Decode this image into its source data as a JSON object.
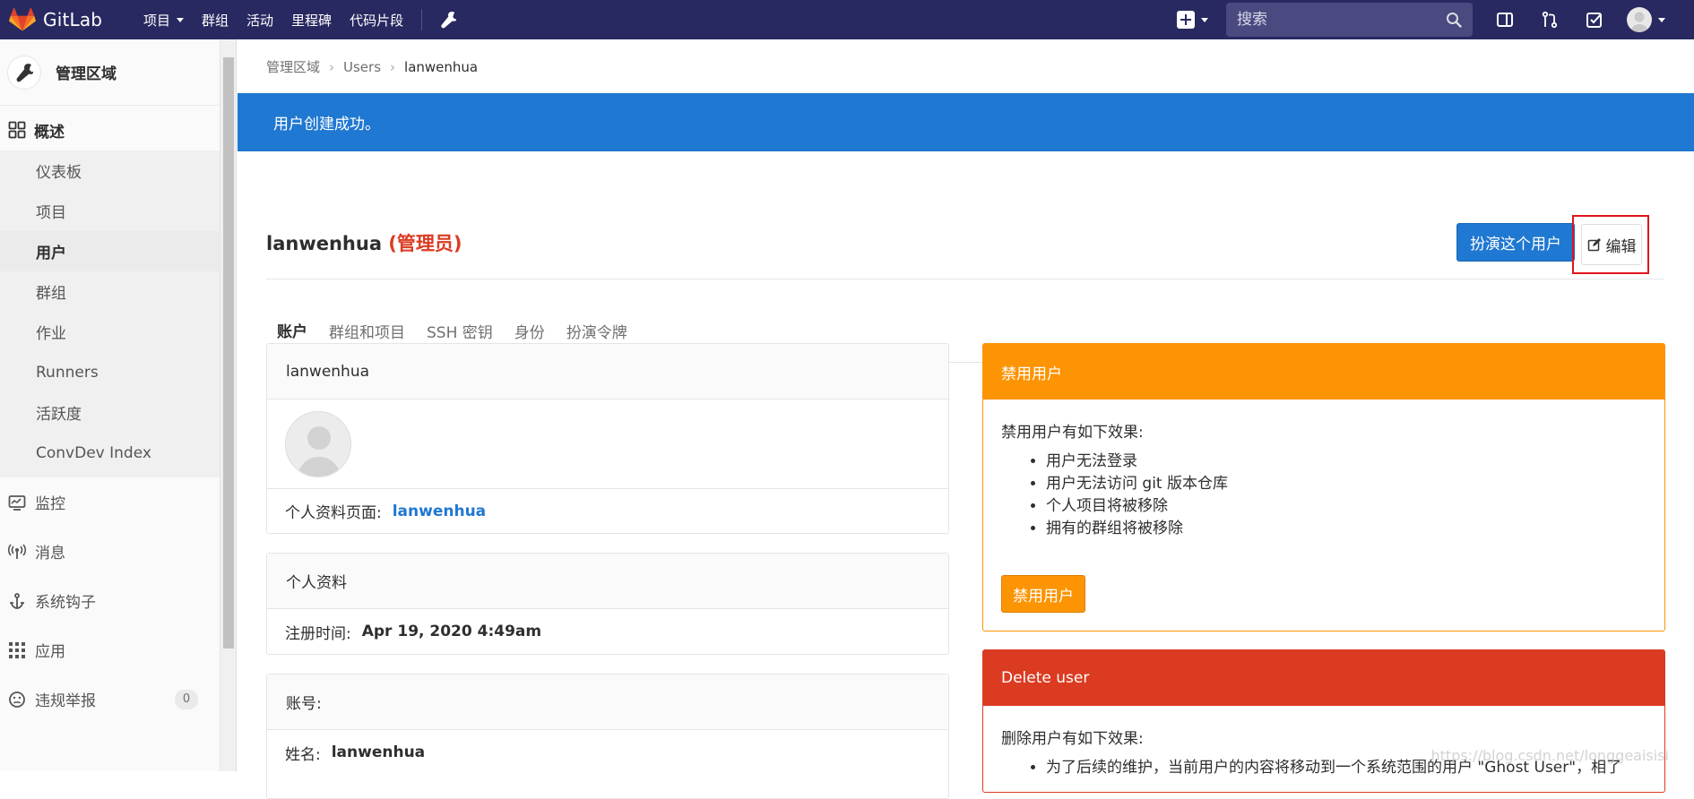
{
  "topbar": {
    "brand": "GitLab",
    "nav": [
      {
        "label": "项目",
        "dropdown": true
      },
      {
        "label": "群组",
        "dropdown": false
      },
      {
        "label": "活动",
        "dropdown": false
      },
      {
        "label": "里程碑",
        "dropdown": false
      },
      {
        "label": "代码片段",
        "dropdown": false
      }
    ],
    "search_placeholder": "搜索",
    "icons": [
      "admin-wrench-icon",
      "new-item-plus-icon",
      "search-icon",
      "sidebar-toggle-icon",
      "merge-request-icon",
      "todo-check-icon",
      "user-avatar"
    ]
  },
  "sidebar": {
    "header_title": "管理区域",
    "overview_label": "概述",
    "sub_items": [
      "仪表板",
      "项目",
      "用户",
      "群组",
      "作业",
      "Runners",
      "活跃度",
      "ConvDev Index"
    ],
    "active_sub": "用户",
    "items": [
      {
        "label": "监控",
        "icon": "monitor-icon"
      },
      {
        "label": "消息",
        "icon": "broadcast-icon"
      },
      {
        "label": "系统钩子",
        "icon": "hook-anchor-icon"
      },
      {
        "label": "应用",
        "icon": "apps-grid-icon"
      },
      {
        "label": "违规举报",
        "icon": "abuse-face-icon",
        "badge": "0"
      }
    ]
  },
  "breadcrumb": [
    "管理区域",
    "Users",
    "lanwenhua"
  ],
  "flash": "用户创建成功。",
  "user": {
    "name": "lanwenhua",
    "role": "(管理员)"
  },
  "actions": {
    "impersonate": "扮演这个用户",
    "edit": "编辑"
  },
  "tabs": [
    "账户",
    "群组和项目",
    "SSH 密钥",
    "身份",
    "扮演令牌"
  ],
  "active_tab": "账户",
  "account_card": {
    "username": "lanwenhua",
    "profile_label": "个人资料页面:",
    "profile_link": "lanwenhua"
  },
  "profile_card": {
    "title": "个人资料",
    "registered_label": "注册时间:",
    "registered_value": "Apr 19, 2020 4:49am"
  },
  "account_info_card": {
    "title": "账号:",
    "name_label": "姓名:",
    "name_value": "lanwenhua"
  },
  "block_panel": {
    "title": "禁用用户",
    "intro": "禁用用户有如下效果:",
    "effects": [
      "用户无法登录",
      "用户无法访问 git 版本仓库",
      "个人项目将被移除",
      "拥有的群组将被移除"
    ],
    "button": "禁用用户",
    "color": "#fc9403"
  },
  "delete_panel": {
    "title": "Delete user",
    "intro": "删除用户有如下效果:",
    "effect_partial": "为了后续的维护，当前用户的内容将移动到一个系统范围的用户 \"Ghost User\"，相了",
    "color": "#db3b21"
  },
  "watermark": "https://blog.csdn.net/longgeaisisi",
  "colors": {
    "navbar": "#292961",
    "primary": "#1f78d1",
    "warning": "#fc9403",
    "danger": "#db3b21"
  }
}
